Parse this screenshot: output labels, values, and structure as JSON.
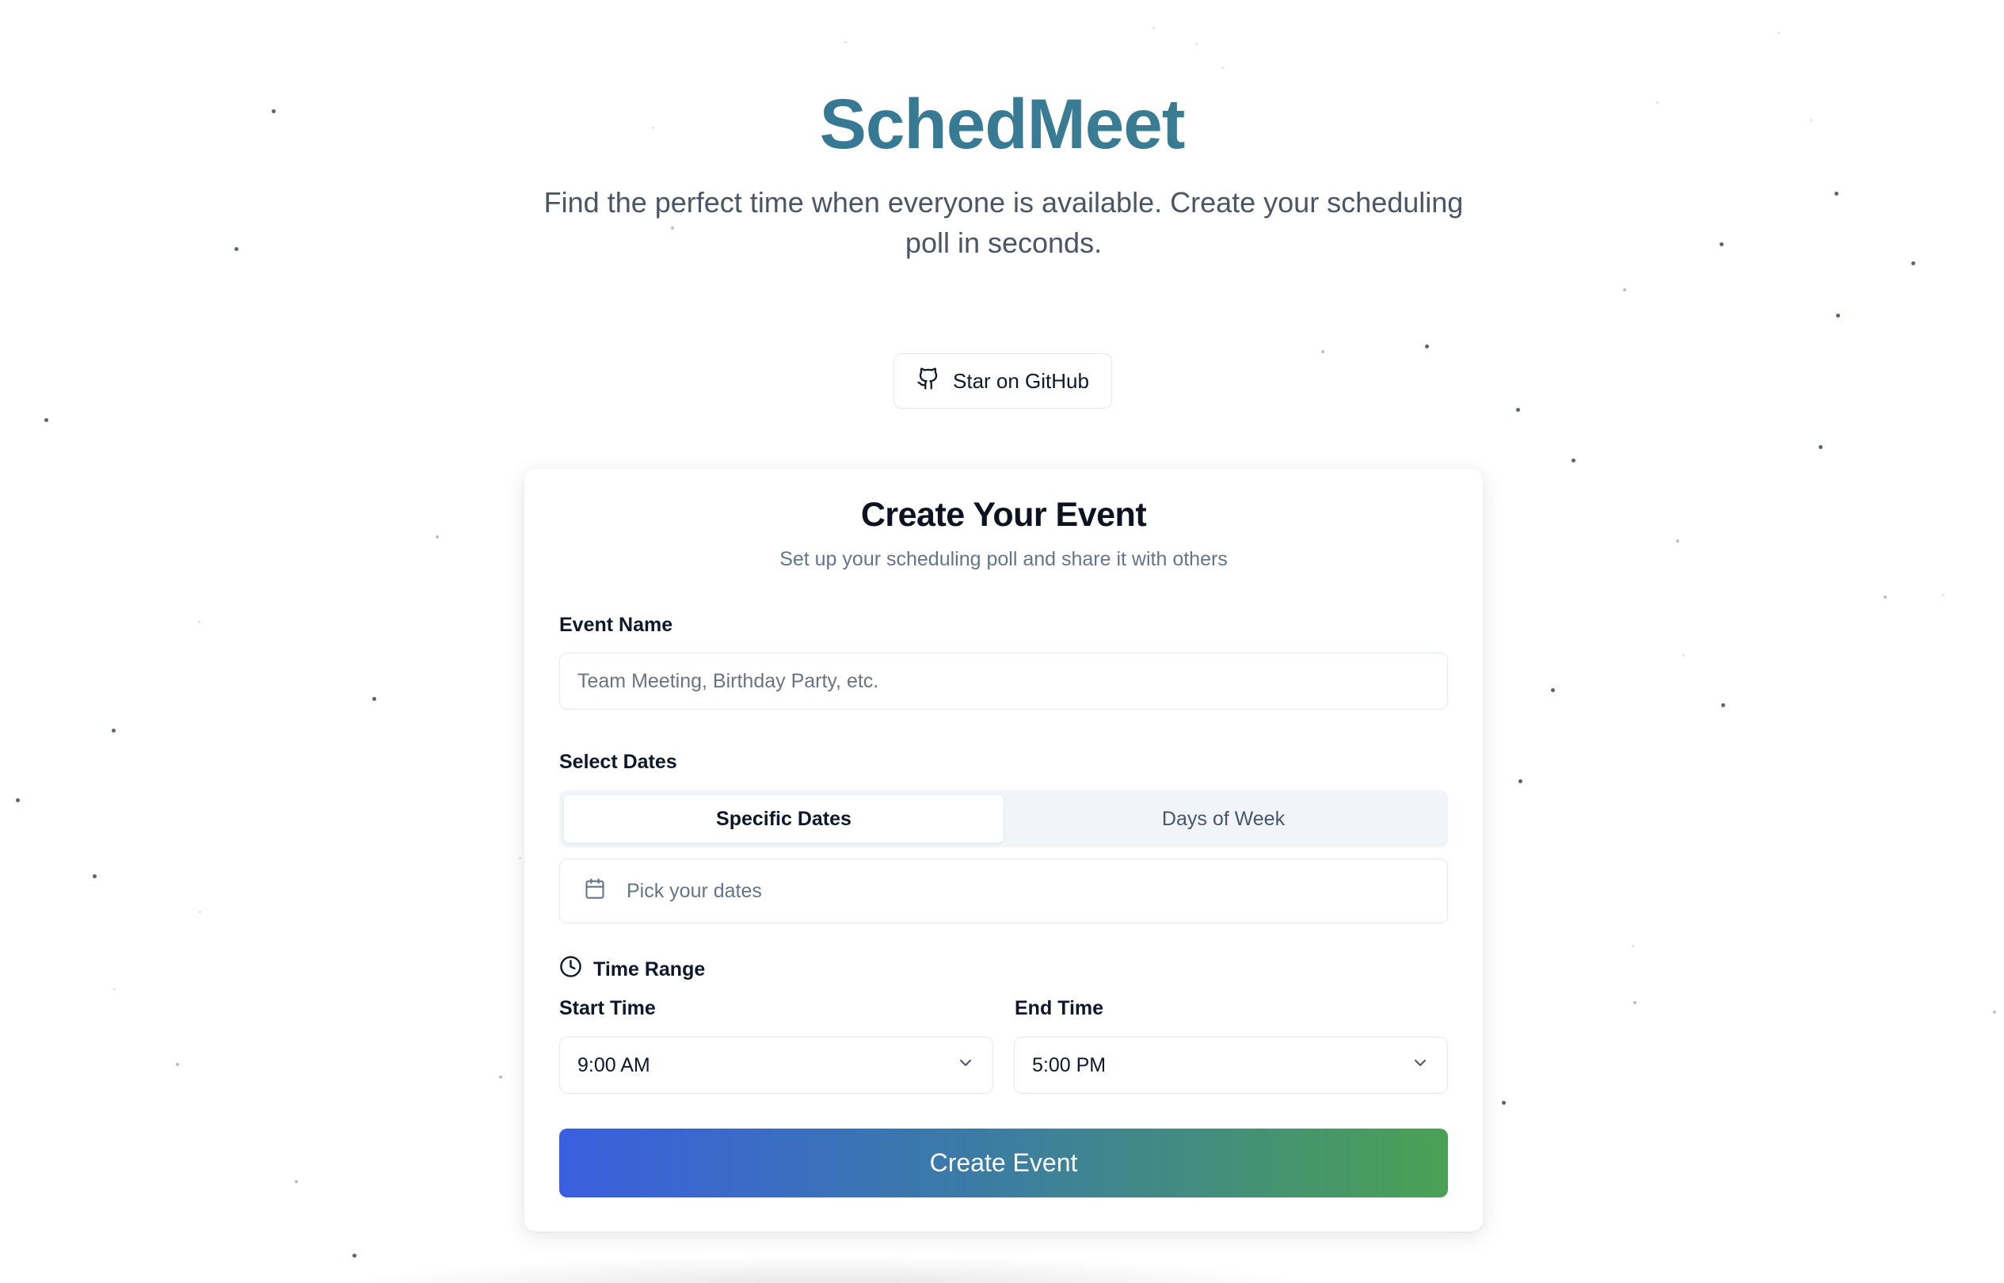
{
  "hero": {
    "title": "SchedMeet",
    "subtitle": "Find the perfect time when everyone is available. Create your scheduling poll in seconds."
  },
  "github_button": {
    "icon": "github-icon",
    "label": "Star on GitHub"
  },
  "card": {
    "title": "Create Your Event",
    "subtitle": "Set up your scheduling poll and share it with others",
    "event_name": {
      "label": "Event Name",
      "placeholder": "Team Meeting, Birthday Party, etc.",
      "value": ""
    },
    "select_dates": {
      "label": "Select Dates",
      "tabs": [
        {
          "label": "Specific Dates",
          "active": true
        },
        {
          "label": "Days of Week",
          "active": false
        }
      ],
      "date_picker": {
        "icon": "calendar-icon",
        "placeholder": "Pick your dates"
      }
    },
    "time_range": {
      "icon": "clock-icon",
      "label": "Time Range",
      "start": {
        "label": "Start Time",
        "value": "9:00 AM"
      },
      "end": {
        "label": "End Time",
        "value": "5:00 PM"
      }
    },
    "submit_label": "Create Event"
  },
  "colors": {
    "title_gradient": [
      "#2f6f9a",
      "#3f8b86"
    ],
    "button_gradient": [
      "#3a5fe0",
      "#3b7aa8",
      "#4aa153"
    ],
    "muted_text": "#64748b",
    "border": "#e2e8f0"
  }
}
